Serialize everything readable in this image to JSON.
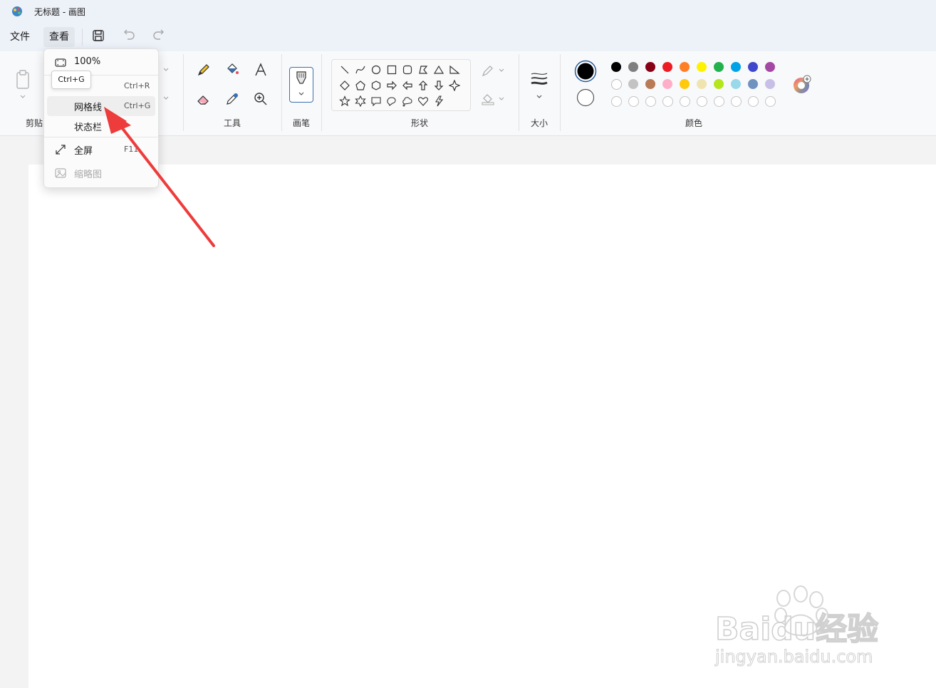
{
  "window": {
    "title": "无标题 - 画图"
  },
  "menubar": {
    "file_label": "文件",
    "view_label": "查看"
  },
  "ribbon": {
    "clipboard_label": "剪贴",
    "tools_label": "工具",
    "brush_label": "画笔",
    "shapes_label": "形状",
    "size_label": "大小",
    "colors_label": "颜色"
  },
  "palette": {
    "row1": [
      "#000000",
      "#7f7f7f",
      "#880015",
      "#ed1c24",
      "#ff7f27",
      "#fff200",
      "#22b14c",
      "#00a2e8",
      "#3f48cc",
      "#a349a4"
    ],
    "row2": [
      "#ffffff",
      "#c3c3c3",
      "#b97a57",
      "#ffaec9",
      "#ffc90e",
      "#efe4b0",
      "#b5e61d",
      "#99d9ea",
      "#7092be",
      "#c8bfe7"
    ],
    "primary": "#000000",
    "secondary": "#ffffff"
  },
  "view_menu": {
    "zoom_label": "100%",
    "ruler_shortcut": "Ctrl+R",
    "gridlines_label": "网格线",
    "gridlines_shortcut": "Ctrl+G",
    "statusbar_label": "状态栏",
    "fullscreen_label": "全屏",
    "fullscreen_shortcut": "F11",
    "thumbnail_label": "缩略图"
  },
  "tooltip": {
    "text": "Ctrl+G"
  },
  "watermark": {
    "brand": "Baidu经验",
    "url": "jingyan.baidu.com"
  },
  "annotation": {
    "arrow_color": "#ee3b3b"
  }
}
